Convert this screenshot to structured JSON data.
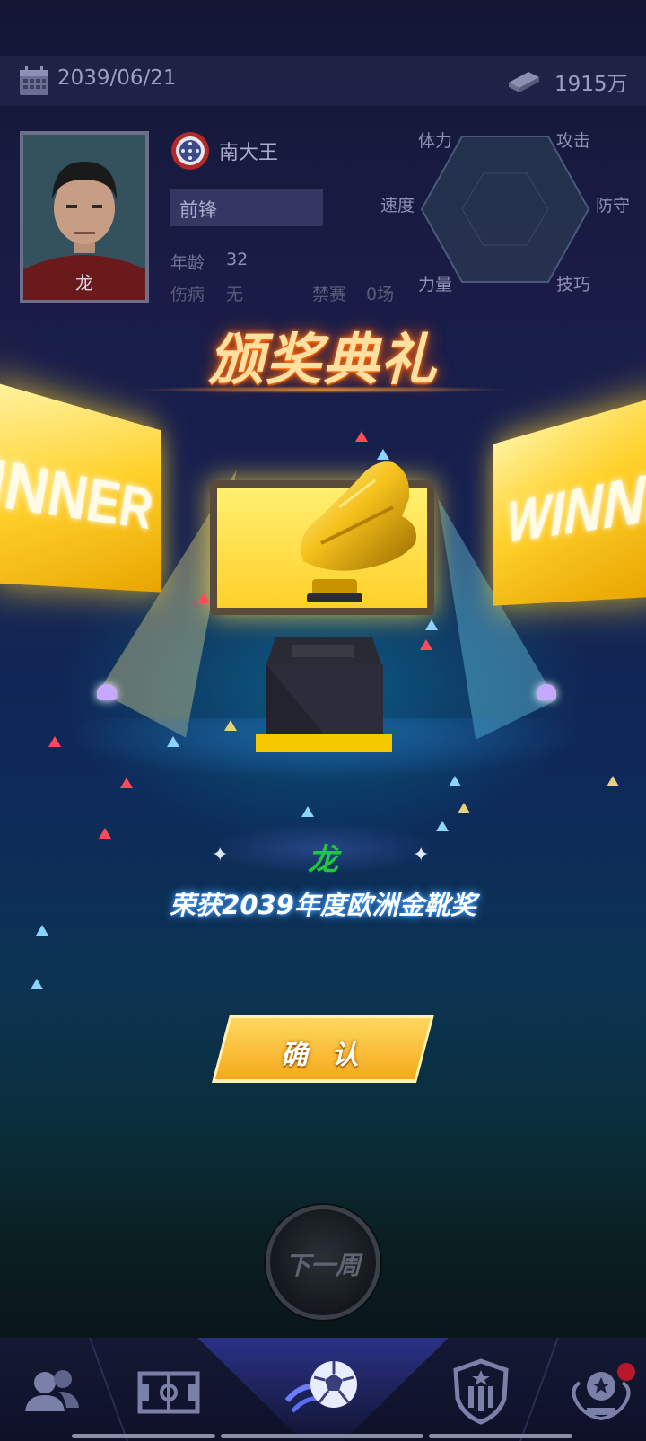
{
  "status": {
    "date": "2039/06/21",
    "money": "1915万"
  },
  "player": {
    "name": "龙",
    "club": "南大王",
    "position": "前锋",
    "age_label": "年龄",
    "age": "32",
    "injury_label": "伤病",
    "injury": "无",
    "ban_label": "禁赛",
    "ban": "0场"
  },
  "radar": {
    "stats": [
      "体力",
      "攻击",
      "速度",
      "防守",
      "力量",
      "技巧"
    ]
  },
  "ceremony": {
    "title": "颁奖典礼",
    "banner_text": "WINNER",
    "winner_name": "龙",
    "award_text": "荣获2039年度欧洲金靴奖",
    "confirm_label": "确 认"
  },
  "controls": {
    "next_week_label": "下一周"
  },
  "nav": {
    "items": [
      "squad-icon",
      "pitch-icon",
      "football-icon",
      "club-crest-icon",
      "trophy-icon"
    ]
  },
  "colors": {
    "title_glow": "#ff7a1a",
    "winner_name": "#22c83a",
    "confirm_button": "#f4a91c",
    "notification_badge": "#b8182a"
  }
}
